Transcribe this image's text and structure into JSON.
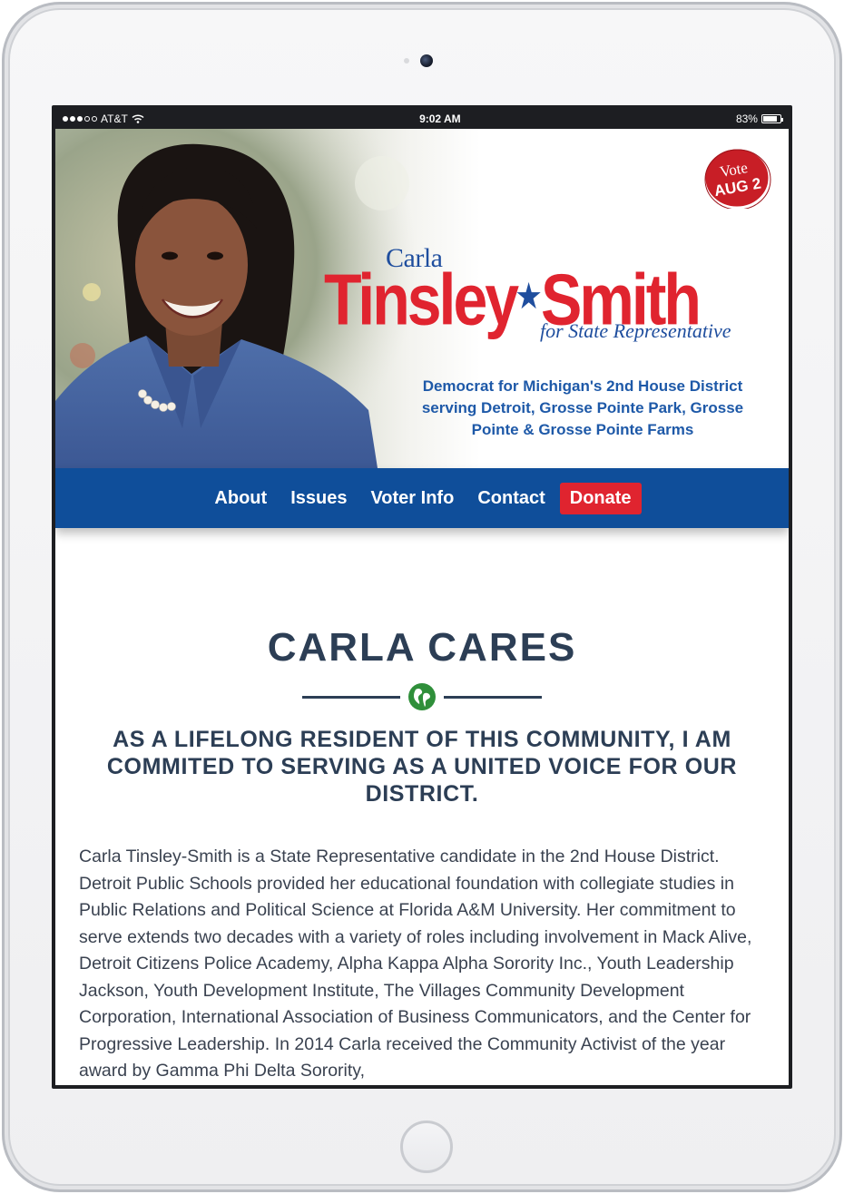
{
  "status_bar": {
    "carrier": "AT&T",
    "time": "9:02 AM",
    "battery_percent": "83%",
    "battery_level": 0.83,
    "signal_bars": 3
  },
  "hero": {
    "vote_badge": {
      "line1": "Vote",
      "line2": "AUG 2"
    },
    "first_name": "Carla",
    "last_name_part1": "Tinsley",
    "last_name_part2": "Smith",
    "star": "★",
    "office": "for State Representative",
    "district": "Democrat for Michigan's 2nd House District serving Detroit, Grosse Pointe Park, Grosse Pointe & Grosse Pointe Farms"
  },
  "nav": {
    "items": [
      "About",
      "Issues",
      "Voter Info",
      "Contact"
    ],
    "donate": "Donate"
  },
  "main": {
    "title": "CARLA CARES",
    "subtitle": "AS A LIFELONG RESIDENT OF THIS COMMUNITY, I AM COMMITED TO SERVING AS A UNITED VOICE FOR OUR DISTRICT.",
    "body": "Carla Tinsley-Smith is a State Representative candidate in the 2nd House District. Detroit Public Schools provided her educational foundation with collegiate studies in Public Relations and Political Science at Florida A&M University. Her commitment to serve extends two decades with a variety of roles including involvement in Mack Alive, Detroit Citizens Police Academy, Alpha Kappa Alpha Sorority Inc., Youth Leadership Jackson, Youth Development Institute, The Villages Community Development Corporation, International Association of Business Communicators, and the Center for Progressive Leadership. In 2014 Carla received the Community Activist of the year award by Gamma Phi Delta Sorority,"
  },
  "colors": {
    "brand_red": "#e0242f",
    "brand_blue": "#1f4e9e",
    "nav_blue": "#0f4e9a",
    "heading": "#2c3e55"
  }
}
